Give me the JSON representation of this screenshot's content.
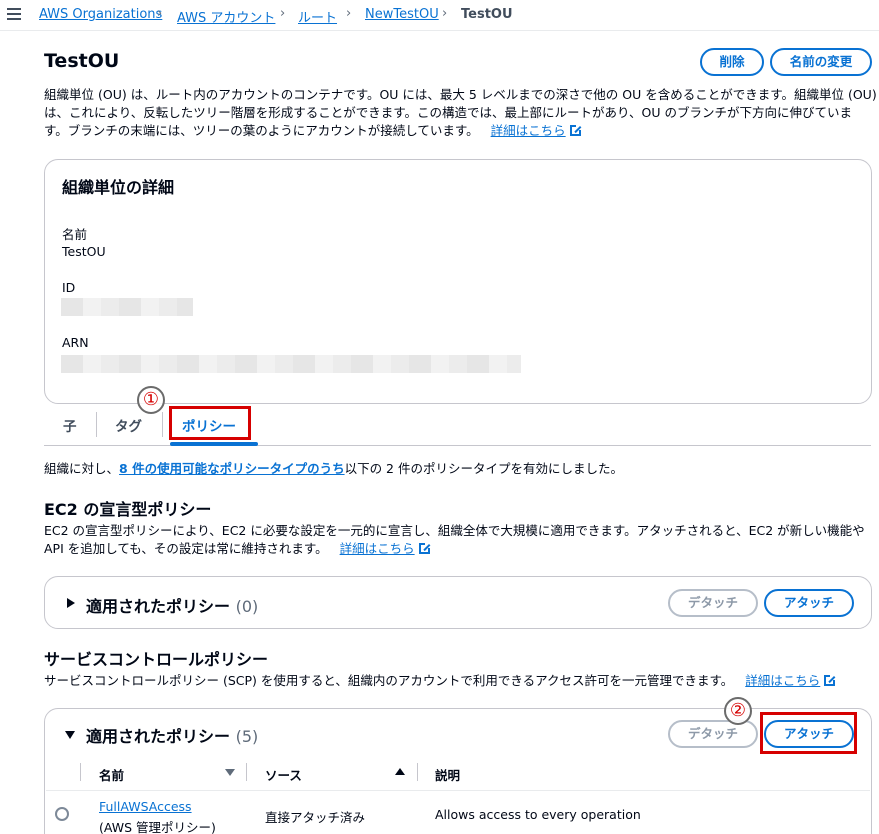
{
  "breadcrumbs": [
    "AWS Organizations",
    "AWS アカウント",
    "ルート",
    "NewTestOU",
    "TestOU"
  ],
  "header": {
    "title": "TestOU",
    "delete_label": "削除",
    "rename_label": "名前の変更",
    "description_lines": [
      "組織単位 (OU) は、ルート内のアカウントのコンテナです。OU には、最大 5 レベルまでの深さで他の OU を含めることができます。組織単位 (OU)",
      "は、これにより、反転したツリー階層を形成することができます。この構造では、最上部にルートがあり、OU のブランチが下方向に伸びていま",
      "す。ブランチの末端には、ツリーの葉のようにアカウントが接続しています。"
    ],
    "learn_more": "詳細はこちら"
  },
  "details": {
    "title": "組織単位の詳細",
    "name_label": "名前",
    "name_value": "TestOU",
    "id_label": "ID",
    "arn_label": "ARN"
  },
  "tabs": {
    "children": "子",
    "tags": "タグ",
    "policies": "ポリシー"
  },
  "annotations": {
    "step1": "①",
    "step2": "②"
  },
  "policy_summary": {
    "prefix": "組織に対し、",
    "link": "8 件の使用可能なポリシータイプのうち",
    "suffix": "以下の 2 件のポリシータイプを有効にしました。"
  },
  "ec2_section": {
    "title": "EC2 の宣言型ポリシー",
    "desc_line1": "EC2 の宣言型ポリシーにより、EC2 に必要な設定を一元的に宣言し、組織全体で大規模に適用できます。アタッチされると、EC2 が新しい機能や",
    "desc_line2": "API を追加しても、その設定は常に維持されます。",
    "learn_more": "詳細はこちら",
    "expander_title": "適用されたポリシー",
    "expander_count": "(0)",
    "detach_label": "デタッチ",
    "attach_label": "アタッチ"
  },
  "scp_section": {
    "title": "サービスコントロールポリシー",
    "desc": "サービスコントロールポリシー (SCP) を使用すると、組織内のアカウントで利用できるアクセス許可を一元管理できます。",
    "learn_more": "詳細はこちら",
    "expander_title": "適用されたポリシー",
    "expander_count": "(5)",
    "detach_label": "デタッチ",
    "attach_label": "アタッチ",
    "columns": [
      "名前",
      "ソース",
      "説明"
    ],
    "rows": [
      {
        "name": "FullAWSAccess",
        "sub": "(AWS 管理ポリシー)",
        "source": "直接アタッチ済み",
        "description": "Allows access to every operation"
      }
    ]
  }
}
